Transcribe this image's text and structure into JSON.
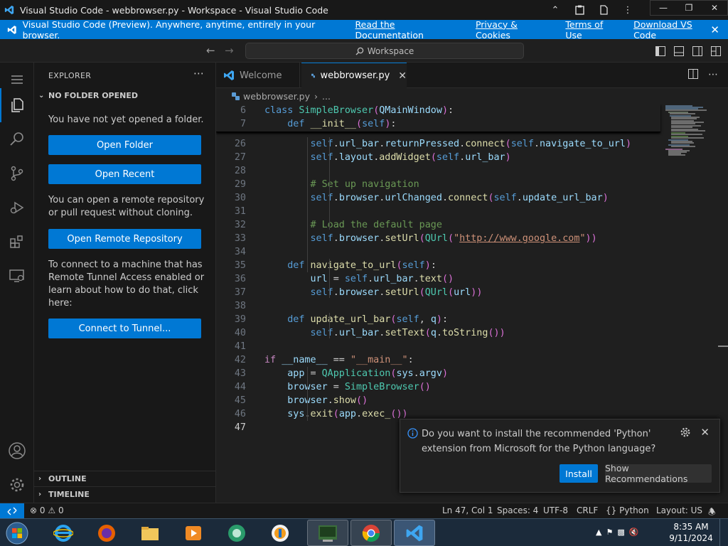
{
  "window": {
    "title": "Visual Studio Code - webbrowser.py - Workspace - Visual Studio Code"
  },
  "banner": {
    "message": "Visual Studio Code (Preview). Anywhere, anytime, entirely in your browser.",
    "links": [
      "Read the Documentation",
      "Privacy & Cookies",
      "Terms of Use",
      "Download VS Code"
    ],
    "close_icon": "close-icon"
  },
  "command_center": {
    "search_text": "Workspace"
  },
  "sidebar": {
    "title": "EXPLORER",
    "section": "NO FOLDER OPENED",
    "no_folder_text": "You have not yet opened a folder.",
    "open_folder_label": "Open Folder",
    "open_recent_label": "Open Recent",
    "remote_text": "You can open a remote repository or pull request without cloning.",
    "open_remote_label": "Open Remote Repository",
    "tunnel_text": "To connect to a machine that has Remote Tunnel Access enabled or learn about how to do that, click here:",
    "tunnel_label": "Connect to Tunnel...",
    "outline_label": "OUTLINE",
    "timeline_label": "TIMELINE"
  },
  "tabs": [
    {
      "label": "Welcome",
      "active": false
    },
    {
      "label": "webbrowser.py",
      "active": true
    }
  ],
  "breadcrumb": {
    "file": "webbrowser.py",
    "more": "..."
  },
  "code": {
    "sticky": [
      {
        "n": "6",
        "text": "class SimpleBrowser(QMainWindow):"
      },
      {
        "n": "7",
        "text": "    def __init__(self):"
      }
    ],
    "lines": [
      {
        "n": "26",
        "text": "        self.url_bar.returnPressed.connect(self.navigate_to_url)"
      },
      {
        "n": "27",
        "text": "        self.layout.addWidget(self.url_bar)"
      },
      {
        "n": "28",
        "text": ""
      },
      {
        "n": "29",
        "text": "        # Set up navigation"
      },
      {
        "n": "30",
        "text": "        self.browser.urlChanged.connect(self.update_url_bar)"
      },
      {
        "n": "31",
        "text": ""
      },
      {
        "n": "32",
        "text": "        # Load the default page"
      },
      {
        "n": "33",
        "text": "        self.browser.setUrl(QUrl(\"http://www.google.com\"))"
      },
      {
        "n": "34",
        "text": ""
      },
      {
        "n": "35",
        "text": "    def navigate_to_url(self):"
      },
      {
        "n": "36",
        "text": "        url = self.url_bar.text()"
      },
      {
        "n": "37",
        "text": "        self.browser.setUrl(QUrl(url))"
      },
      {
        "n": "38",
        "text": ""
      },
      {
        "n": "39",
        "text": "    def update_url_bar(self, q):"
      },
      {
        "n": "40",
        "text": "        self.url_bar.setText(q.toString())"
      },
      {
        "n": "41",
        "text": ""
      },
      {
        "n": "42",
        "text": "if __name__ == \"__main__\":"
      },
      {
        "n": "43",
        "text": "    app = QApplication(sys.argv)"
      },
      {
        "n": "44",
        "text": "    browser = SimpleBrowser()"
      },
      {
        "n": "45",
        "text": "    browser.show()"
      },
      {
        "n": "46",
        "text": "    sys.exit(app.exec_())"
      },
      {
        "n": "47",
        "text": ""
      }
    ],
    "current_line": "47"
  },
  "notification": {
    "message": "Do you want to install the recommended 'Python' extension from Microsoft for the Python language?",
    "install_label": "Install",
    "show_label": "Show Recommendations"
  },
  "statusbar": {
    "problems": "0",
    "warnings": "0",
    "position": "Ln 47, Col 1",
    "spaces": "Spaces: 4",
    "encoding": "UTF-8",
    "eol": "CRLF",
    "language": "Python",
    "layout": "Layout: US"
  },
  "taskbar": {
    "time": "8:35 AM",
    "date": "9/11/2024"
  },
  "colors": {
    "accent": "#0078d4",
    "editor_bg": "#1f1f1f",
    "sidebar_bg": "#181818"
  }
}
